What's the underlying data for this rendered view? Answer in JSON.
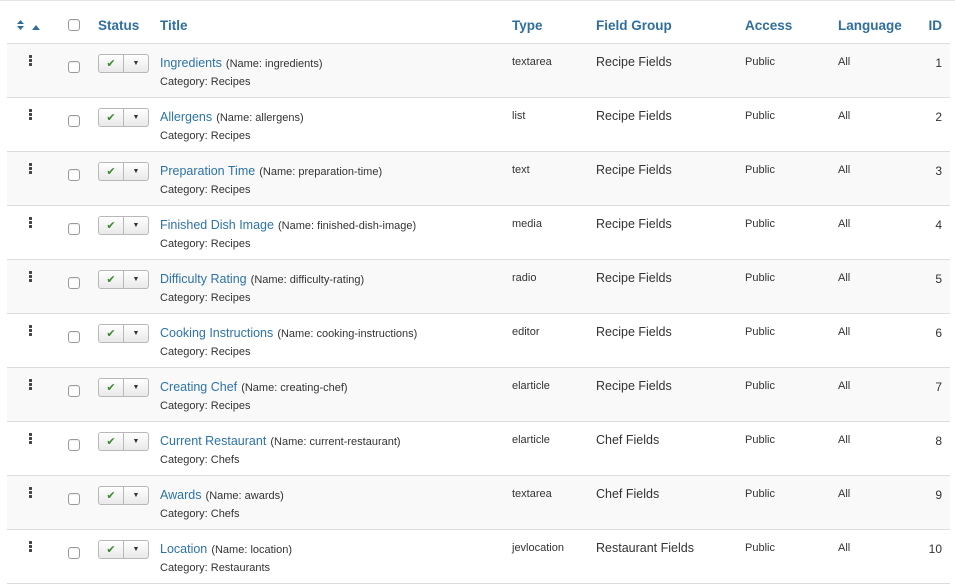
{
  "headers": {
    "status": "Status",
    "title": "Title",
    "type": "Type",
    "field_group": "Field Group",
    "access": "Access",
    "language": "Language",
    "id": "ID"
  },
  "icons": {
    "sort_updown": "sort-updown-icon",
    "sort_asc": "sort-ascending-icon",
    "drag_handle": "drag-handle-icon",
    "published_check": "check-icon",
    "dropdown_caret": "caret-down-icon"
  },
  "colors": {
    "link": "#2d73a9",
    "header": "#2f6f9f",
    "published": "#3a8a2e"
  },
  "rows": [
    {
      "title": "Ingredients",
      "name_note": "(Name: ingredients)",
      "category": "Category: Recipes",
      "type": "textarea",
      "group": "Recipe Fields",
      "access": "Public",
      "language": "All",
      "id": "1"
    },
    {
      "title": "Allergens",
      "name_note": "(Name: allergens)",
      "category": "Category: Recipes",
      "type": "list",
      "group": "Recipe Fields",
      "access": "Public",
      "language": "All",
      "id": "2"
    },
    {
      "title": "Preparation Time",
      "name_note": "(Name: preparation-time)",
      "category": "Category: Recipes",
      "type": "text",
      "group": "Recipe Fields",
      "access": "Public",
      "language": "All",
      "id": "3"
    },
    {
      "title": "Finished Dish Image",
      "name_note": "(Name: finished-dish-image)",
      "category": "Category: Recipes",
      "type": "media",
      "group": "Recipe Fields",
      "access": "Public",
      "language": "All",
      "id": "4"
    },
    {
      "title": "Difficulty Rating",
      "name_note": "(Name: difficulty-rating)",
      "category": "Category: Recipes",
      "type": "radio",
      "group": "Recipe Fields",
      "access": "Public",
      "language": "All",
      "id": "5"
    },
    {
      "title": "Cooking Instructions",
      "name_note": "(Name: cooking-instructions)",
      "category": "Category: Recipes",
      "type": "editor",
      "group": "Recipe Fields",
      "access": "Public",
      "language": "All",
      "id": "6"
    },
    {
      "title": "Creating Chef",
      "name_note": "(Name: creating-chef)",
      "category": "Category: Recipes",
      "type": "elarticle",
      "group": "Recipe Fields",
      "access": "Public",
      "language": "All",
      "id": "7"
    },
    {
      "title": "Current Restaurant",
      "name_note": "(Name: current-restaurant)",
      "category": "Category: Chefs",
      "type": "elarticle",
      "group": "Chef Fields",
      "access": "Public",
      "language": "All",
      "id": "8"
    },
    {
      "title": "Awards",
      "name_note": "(Name: awards)",
      "category": "Category: Chefs",
      "type": "textarea",
      "group": "Chef Fields",
      "access": "Public",
      "language": "All",
      "id": "9"
    },
    {
      "title": "Location",
      "name_note": "(Name: location)",
      "category": "Category: Restaurants",
      "type": "jevlocation",
      "group": "Restaurant Fields",
      "access": "Public",
      "language": "All",
      "id": "10"
    }
  ]
}
